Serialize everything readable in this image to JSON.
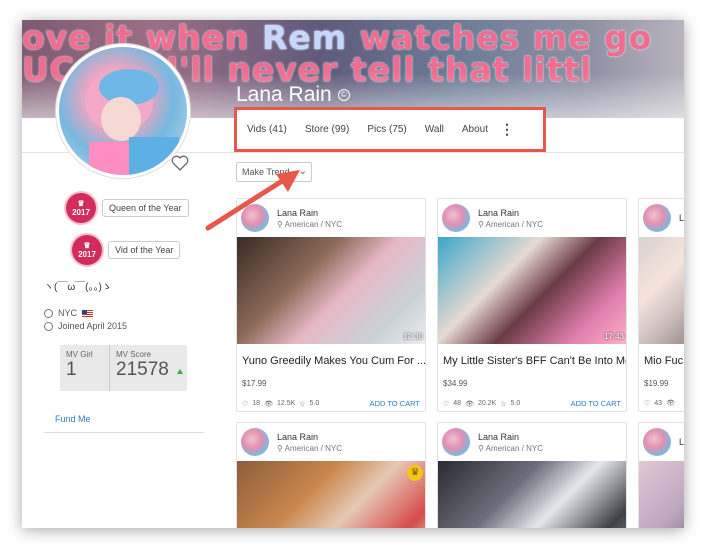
{
  "banner": {
    "line1_a": "ove it when ",
    "line1_b": "Rem",
    "line1_c": " watches me go",
    "line2": "UC  but I'll never tell that littl"
  },
  "profile": {
    "name": "Lana Rain",
    "name_badge": "©",
    "kaomoji": "ヽ(￣ω￣(。。)ゝ",
    "location": "NYC",
    "joined": "Joined April 2015",
    "fund": "Fund Me"
  },
  "awards": [
    {
      "year": "2017",
      "label": "Queen of the Year"
    },
    {
      "year": "2017",
      "label": "Vid of the Year"
    }
  ],
  "scores": {
    "girl_label": "MV Girl",
    "girl_value": "1",
    "score_label": "MV Score",
    "score_value": "21578"
  },
  "nav": {
    "tabs": [
      "Vids (41)",
      "Store (99)",
      "Pics (75)",
      "Wall",
      "About"
    ],
    "more": "⋮"
  },
  "sort": {
    "label": "Make Trend"
  },
  "cards": [
    {
      "author": "Lana Rain",
      "loc": "American / NYC",
      "duration": "12:30",
      "title": "Yuno Greedily Makes You Cum For ...",
      "price": "$17.99",
      "likes": "18",
      "views": "12.5K",
      "rating": "5.0",
      "cart": "ADD TO CART"
    },
    {
      "author": "Lana Rain",
      "loc": "American / NYC",
      "duration": "17:43",
      "title": "My Little Sister's BFF Can't Be Into Me",
      "price": "$34.99",
      "likes": "48",
      "views": "20.2K",
      "rating": "5.0",
      "cart": "ADD TO CART"
    },
    {
      "author": "L",
      "loc": "",
      "duration": "",
      "title": "Mio Fuc",
      "price": "$19.99",
      "likes": "43",
      "views": "",
      "rating": "",
      "cart": ""
    },
    {
      "author": "Lana Rain",
      "loc": "American / NYC"
    },
    {
      "author": "Lana Rain",
      "loc": "American / NYC"
    },
    {
      "author": "L",
      "loc": ""
    }
  ],
  "colors": {
    "accent": "#d32c5c",
    "link": "#2f7ec6",
    "highlight_box": "#e8574a"
  }
}
